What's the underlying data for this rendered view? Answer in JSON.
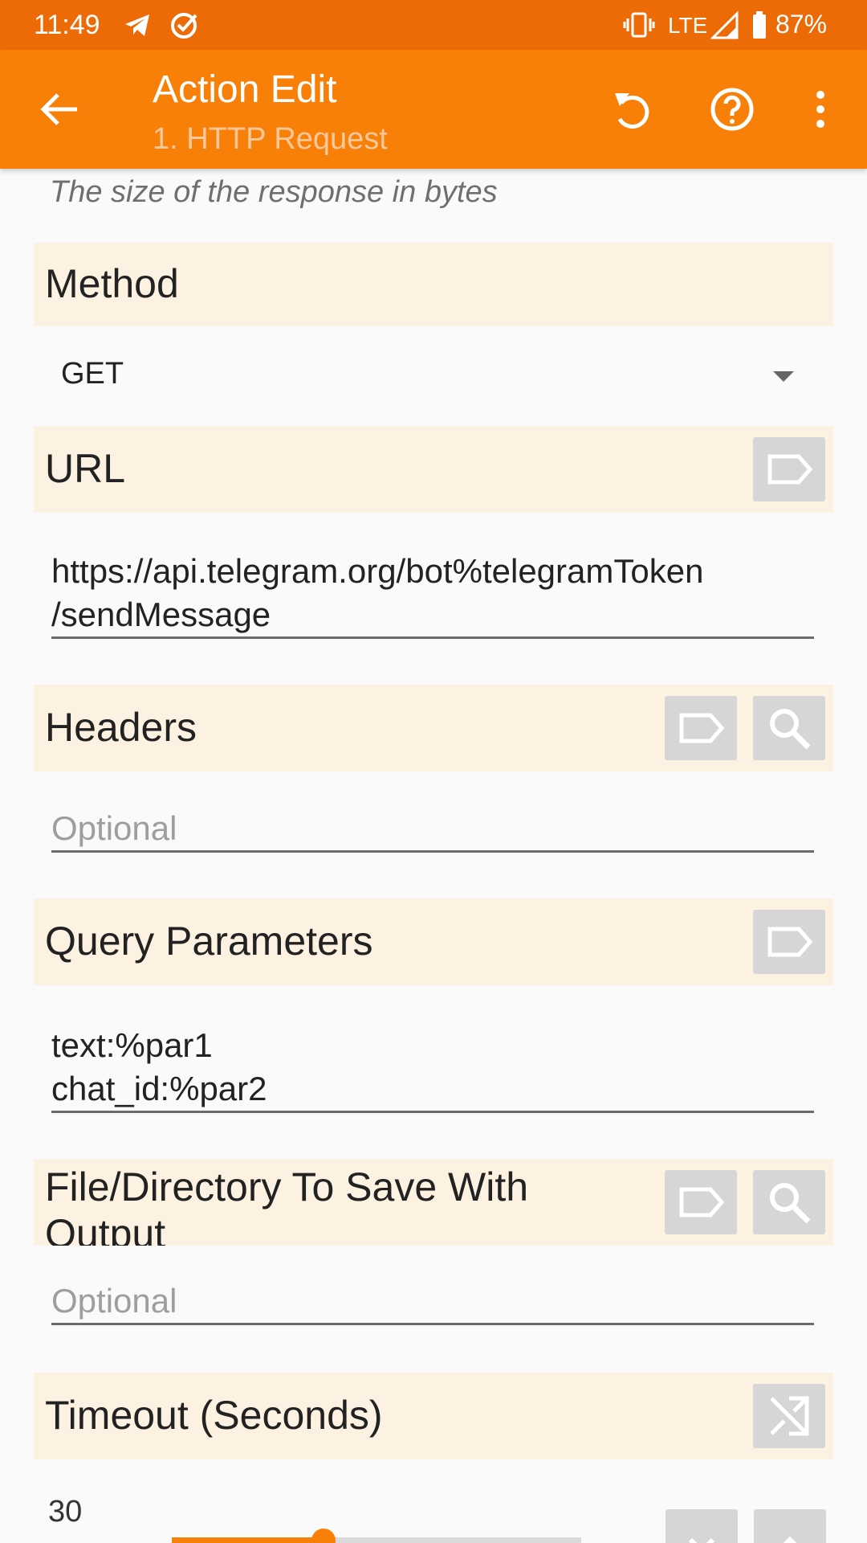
{
  "status_bar": {
    "time": "11:49",
    "network": "LTE",
    "battery": "87%",
    "left_icons": [
      "telegram-icon",
      "check-circle-icon"
    ],
    "right_icons": [
      "vibrate-icon",
      "signal-icon",
      "battery-icon"
    ]
  },
  "app_bar": {
    "title": "Action Edit",
    "subtitle": "1. HTTP Request",
    "actions": [
      "undo-icon",
      "help-icon",
      "overflow-menu-icon"
    ]
  },
  "colors": {
    "status_bar": "#ec6b06",
    "app_bar": "#f88008",
    "section_header": "#fdf1e1",
    "accent": "#f88008"
  },
  "prev_hint": "The size of the response in bytes",
  "method": {
    "label": "Method",
    "value": "GET"
  },
  "url": {
    "label": "URL",
    "value_line1": "https://api.telegram.org/bot%telegramToken",
    "value_line2": "/sendMessage"
  },
  "headers": {
    "label": "Headers",
    "placeholder": "Optional"
  },
  "query": {
    "label": "Query Parameters",
    "line1": "text:%par1",
    "line2": "chat_id:%par2"
  },
  "file_save": {
    "label_line1": "File/Directory To Save With",
    "label_line2": "Output",
    "placeholder": "Optional"
  },
  "timeout": {
    "label": "Timeout (Seconds)",
    "value": "30",
    "slider_fraction": 0.37
  }
}
